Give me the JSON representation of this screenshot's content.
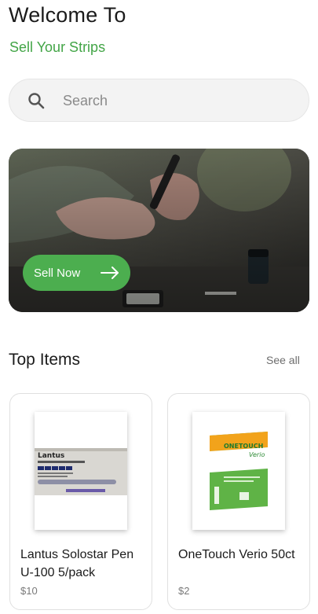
{
  "header": {
    "title": "Welcome To",
    "subtitle": "Sell Your Strips"
  },
  "search": {
    "placeholder": "Search",
    "icon": "search-icon"
  },
  "banner": {
    "button_label": "Sell Now",
    "button_icon": "arrow-right-icon"
  },
  "top_items": {
    "title": "Top Items",
    "see_all_label": "See all",
    "items": [
      {
        "name": "Lantus Solostar Pen U-100 5/pack",
        "price": "$10",
        "box_brand": "Lantus"
      },
      {
        "name": "OneTouch Verio 50ct",
        "price": "$2",
        "box_brand": "ONETOUCH",
        "box_sub": "Verio"
      }
    ]
  },
  "colors": {
    "accent": "#43a547",
    "button": "#4cae4f"
  }
}
